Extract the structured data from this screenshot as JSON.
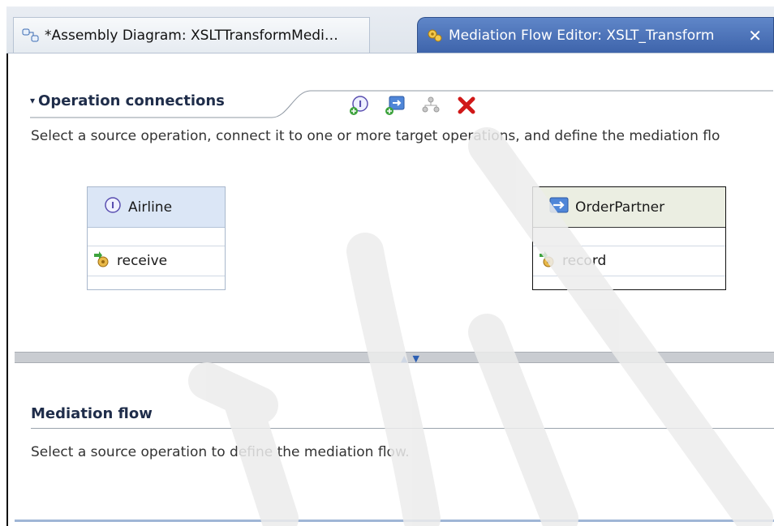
{
  "tabs": [
    {
      "label": "*Assembly Diagram: XSLTTransformMedi…",
      "icon": "assembly-diagram-icon",
      "active": false
    },
    {
      "label": "Mediation Flow Editor: XSLT_Transform",
      "icon": "mediation-flow-editor-icon",
      "active": true,
      "close": "✕"
    }
  ],
  "operation_connections": {
    "title": "Operation connections",
    "twisty": "▾",
    "description": "Select a source operation, connect it to one or more target operations, and define the mediation flo",
    "toolbar": [
      "add-interface-icon",
      "add-reference-icon",
      "connect-operations-icon",
      "delete-icon"
    ]
  },
  "source": {
    "name": "Airline",
    "icon": "interface-icon",
    "operations": [
      "receive"
    ]
  },
  "target": {
    "name": "OrderPartner",
    "icon": "reference-icon",
    "operations": [
      "record"
    ]
  },
  "mediation_flow": {
    "title": "Mediation flow",
    "description": "Select a source operation to define the mediation flow."
  },
  "colors": {
    "active_tab": "#4a6fb4",
    "source_header": "#dbe6f6",
    "target_header": "#ebeee2",
    "delete_red": "#d01818"
  }
}
